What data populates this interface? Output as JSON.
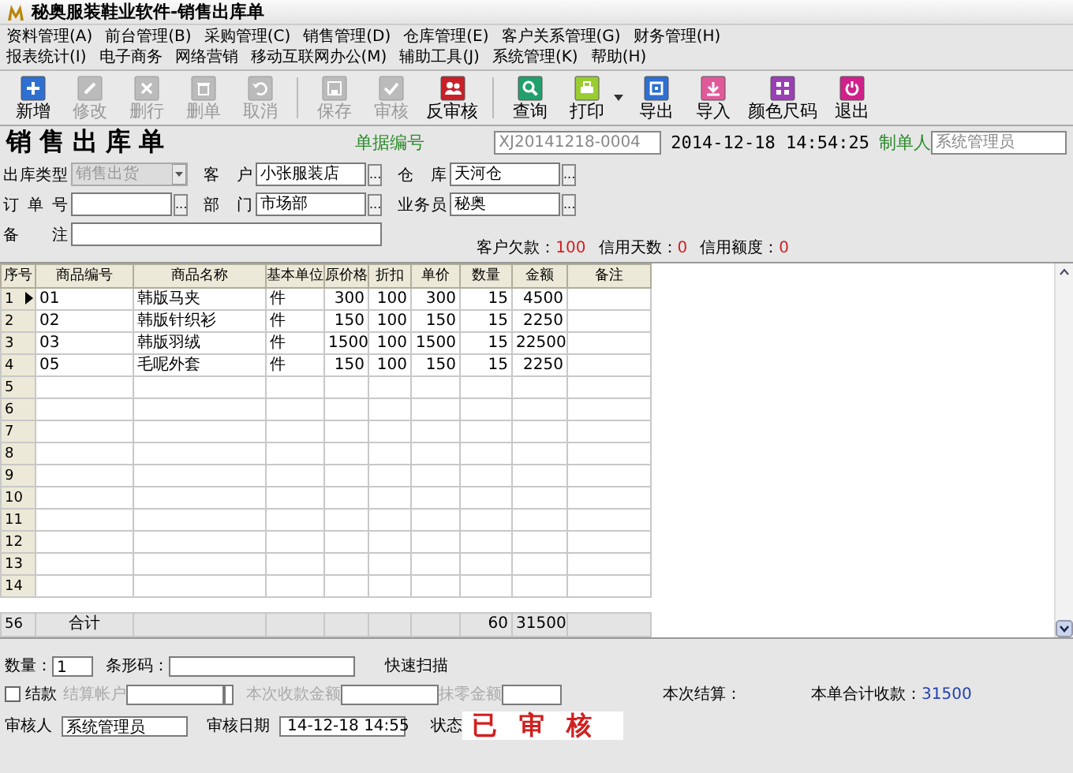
{
  "window": {
    "title": "秘奥服装鞋业软件-销售出库单"
  },
  "menu_bar": {
    "rows": [
      [
        "资料管理(A)",
        "前台管理(B)",
        "采购管理(C)",
        "销售管理(D)",
        "仓库管理(E)",
        "客户关系管理(G)",
        "财务管理(H)"
      ],
      [
        "报表统计(I)",
        "电子商务",
        "网络营销",
        "移动互联网办公(M)",
        "辅助工具(J)",
        "系统管理(K)",
        "帮助(H)"
      ]
    ]
  },
  "toolbar": [
    {
      "label": "新增",
      "kind": "new",
      "disabled": false,
      "separator_before": false,
      "dropdown": false
    },
    {
      "label": "修改",
      "kind": "edit",
      "disabled": true,
      "separator_before": false,
      "dropdown": false
    },
    {
      "label": "删行",
      "kind": "delete_row",
      "disabled": true,
      "separator_before": false,
      "dropdown": false
    },
    {
      "label": "删单",
      "kind": "delete_doc",
      "disabled": true,
      "separator_before": false,
      "dropdown": false
    },
    {
      "label": "取消",
      "kind": "cancel",
      "disabled": true,
      "separator_before": false,
      "dropdown": false
    },
    {
      "label": "保存",
      "kind": "save",
      "disabled": true,
      "separator_before": true,
      "dropdown": false
    },
    {
      "label": "审核",
      "kind": "approve",
      "disabled": true,
      "separator_before": false,
      "dropdown": false
    },
    {
      "label": "反审核",
      "kind": "unapprove",
      "disabled": false,
      "separator_before": false,
      "dropdown": false
    },
    {
      "label": "查询",
      "kind": "search",
      "disabled": false,
      "separator_before": true,
      "dropdown": false
    },
    {
      "label": "打印",
      "kind": "print",
      "disabled": false,
      "separator_before": false,
      "dropdown": true
    },
    {
      "label": "导出",
      "kind": "export",
      "disabled": false,
      "separator_before": false,
      "dropdown": false
    },
    {
      "label": "导入",
      "kind": "import",
      "disabled": false,
      "separator_before": false,
      "dropdown": false
    },
    {
      "label": "颜色尺码",
      "kind": "color_size",
      "disabled": false,
      "separator_before": false,
      "dropdown": false
    },
    {
      "label": "退出",
      "kind": "exit",
      "disabled": false,
      "separator_before": false,
      "dropdown": false
    }
  ],
  "form": {
    "heading": "销售出库单",
    "doc_number": {
      "label": "单据编号",
      "value": "XJ20141218-0004"
    },
    "created_at": "2014-12-18 14:54:25",
    "maker": {
      "label": "制单人",
      "value": "系统管理员"
    },
    "fields": [
      {
        "label": "出库类型",
        "value": "销售出货",
        "kind": "dropdown",
        "disabled": true
      },
      {
        "label": "客户",
        "value": "小张服装店",
        "kind": "browse",
        "button": "...",
        "disabled": false
      },
      {
        "label": "仓库",
        "value": "天河仓",
        "kind": "browse",
        "button": "...",
        "disabled": false
      },
      {
        "label": "订单号",
        "kind": "browse",
        "button": "...",
        "disabled": false
      },
      {
        "label": "部门",
        "value": "市场部",
        "kind": "browse",
        "button": "...",
        "disabled": false
      },
      {
        "label": "业务员",
        "value": "秘奥",
        "kind": "browse",
        "button": "...",
        "disabled": false
      },
      {
        "label": "备注",
        "kind": "text",
        "disabled": false
      }
    ],
    "credit": [
      {
        "label": "客户欠款：",
        "value": "100"
      },
      {
        "label": "信用天数：",
        "value": "0"
      },
      {
        "label": "信用额度：",
        "value": "0"
      }
    ]
  },
  "grid": {
    "columns": [
      "序号",
      "商品编号",
      "商品名称",
      "基本单位",
      "原价格",
      "折扣",
      "单价",
      "数量",
      "金额",
      "备注"
    ],
    "rows": [
      {
        "number": "1",
        "current": true,
        "cells": [
          "01",
          "韩版马夹",
          "件",
          "300",
          "100",
          "300",
          "15",
          "4500"
        ]
      },
      {
        "number": "2",
        "current": false,
        "cells": [
          "02",
          "韩版针织衫",
          "件",
          "150",
          "100",
          "150",
          "15",
          "2250"
        ]
      },
      {
        "number": "3",
        "current": false,
        "cells": [
          "03",
          "韩版羽绒",
          "件",
          "1500",
          "100",
          "1500",
          "15",
          "22500"
        ]
      },
      {
        "number": "4",
        "current": false,
        "cells": [
          "05",
          "毛呢外套",
          "件",
          "150",
          "100",
          "150",
          "15",
          "2250"
        ]
      },
      {
        "number": "5",
        "current": false
      },
      {
        "number": "6",
        "current": false
      },
      {
        "number": "7",
        "current": false
      },
      {
        "number": "8",
        "current": false
      },
      {
        "number": "9",
        "current": false
      },
      {
        "number": "10",
        "current": false
      },
      {
        "number": "11",
        "current": false
      },
      {
        "number": "12",
        "current": false
      },
      {
        "number": "13",
        "current": false
      },
      {
        "number": "14",
        "current": false
      }
    ],
    "total": {
      "number": "56",
      "label": "合计",
      "quantity": "60",
      "amount": "31500"
    }
  },
  "entry": {
    "quantity_label": "数量：",
    "quantity": "1",
    "barcode_label": "条形码：",
    "scan_label": "快速扫描"
  },
  "settlement": {
    "checkbox_label": "结款",
    "checked": false,
    "disabled": true,
    "account_label": "结算帐户",
    "received_label": "本次收款金额",
    "rounding_label": "抹零金额",
    "this_settlement_label": "本次结算：",
    "total_label": "本单合计收款：",
    "total": "31500"
  },
  "review": {
    "reviewer_label": "审核人",
    "reviewer": "系统管理员",
    "date_label": "审核日期",
    "date": "14-12-18 14:55",
    "status_label": "状态",
    "status": "已审核"
  }
}
